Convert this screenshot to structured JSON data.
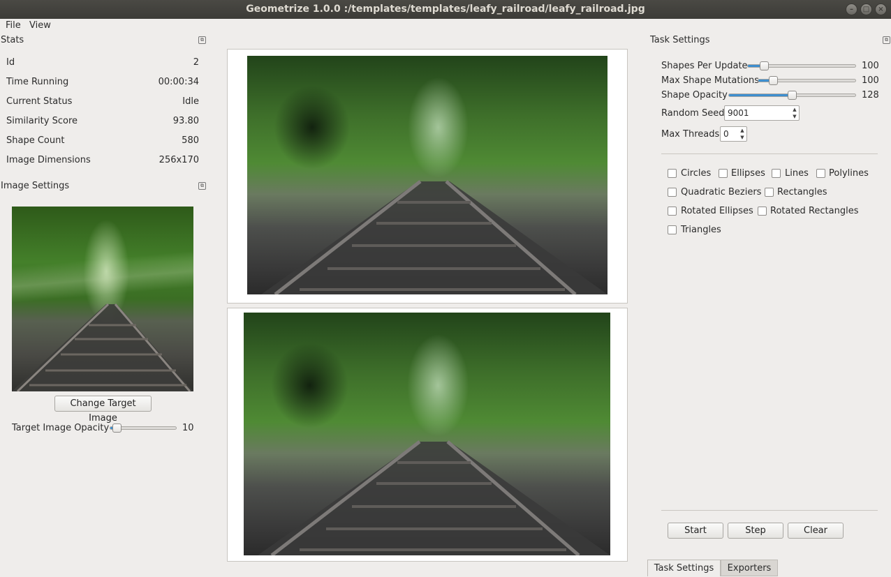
{
  "window": {
    "title": "Geometrize 1.0.0 :/templates/templates/leafy_railroad/leafy_railroad.jpg",
    "minimize": "–",
    "maximize": "□",
    "close": "×"
  },
  "menu": {
    "file": "File",
    "view": "View"
  },
  "stats": {
    "title": "Stats",
    "rows": [
      {
        "label": "Id",
        "value": "2"
      },
      {
        "label": "Time Running",
        "value": "00:00:34"
      },
      {
        "label": "Current Status",
        "value": "Idle"
      },
      {
        "label": "Similarity Score",
        "value": "93.80"
      },
      {
        "label": "Shape Count",
        "value": "580"
      },
      {
        "label": "Image Dimensions",
        "value": "256x170"
      }
    ]
  },
  "image_settings": {
    "title": "Image Settings",
    "change_button": "Change Target Image",
    "opacity_label": "Target Image Opacity",
    "opacity_value": "10",
    "opacity_fraction": 0.04
  },
  "task_settings": {
    "title": "Task Settings",
    "shapes_per_update": {
      "label": "Shapes Per Update",
      "value": "100",
      "fraction": 0.12
    },
    "max_shape_mutations": {
      "label": "Max Shape Mutations",
      "value": "100",
      "fraction": 0.12
    },
    "shape_opacity": {
      "label": "Shape Opacity",
      "value": "128",
      "fraction": 0.5
    },
    "random_seed": {
      "label": "Random Seed",
      "value": "9001"
    },
    "max_threads": {
      "label": "Max Threads",
      "value": "0"
    },
    "shapes": {
      "circles": "Circles",
      "ellipses": "Ellipses",
      "lines": "Lines",
      "polylines": "Polylines",
      "quadratic_beziers": "Quadratic Beziers",
      "rectangles": "Rectangles",
      "rotated_ellipses": "Rotated Ellipses",
      "rotated_rectangles": "Rotated Rectangles",
      "triangles": "Triangles"
    },
    "start": "Start",
    "step": "Step",
    "clear": "Clear"
  },
  "tabs": {
    "task_settings": "Task Settings",
    "exporters": "Exporters"
  }
}
